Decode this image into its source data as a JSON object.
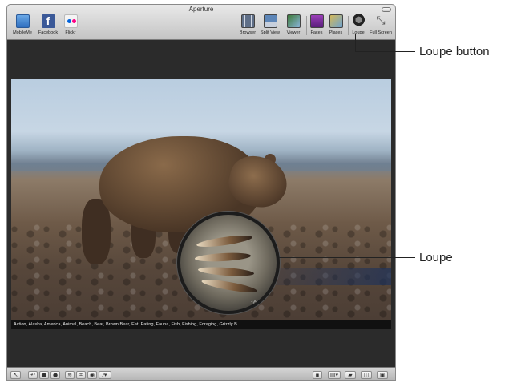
{
  "window": {
    "title": "Aperture"
  },
  "toolbar": {
    "share": [
      {
        "label": "MobileMe",
        "icon": "mobileme-icon"
      },
      {
        "label": "Facebook",
        "icon": "facebook-icon"
      },
      {
        "label": "Flickr",
        "icon": "flickr-icon"
      }
    ],
    "views": [
      {
        "label": "Browser",
        "icon": "browser-icon"
      },
      {
        "label": "Split View",
        "icon": "split-view-icon"
      },
      {
        "label": "Viewer",
        "icon": "viewer-icon"
      }
    ],
    "organize": [
      {
        "label": "Faces",
        "icon": "faces-icon"
      },
      {
        "label": "Places",
        "icon": "places-icon"
      }
    ],
    "tools": [
      {
        "label": "Loupe",
        "icon": "loupe-icon"
      },
      {
        "label": "Full Screen",
        "icon": "full-screen-icon"
      }
    ]
  },
  "photo": {
    "keywords": "Action, Alaska, America, Animal, Beach, Bear, Brown Bear, Eat, Eating, Fauna, Fish, Fishing, Foraging, Grizzly B...",
    "loupe_zoom": "100 ▾"
  },
  "callouts": {
    "loupe_button": "Loupe button",
    "loupe": "Loupe"
  },
  "colors": {
    "viewer_bg": "#2b2b2b",
    "toolbar_bg": "#d4d4d4"
  }
}
